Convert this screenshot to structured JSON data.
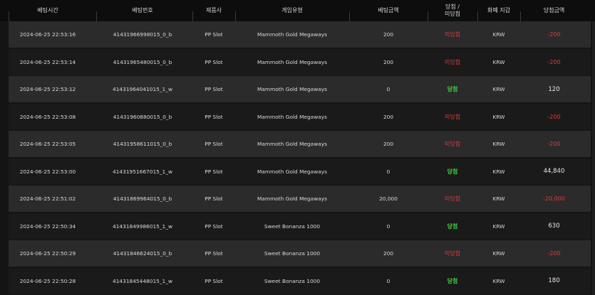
{
  "header": {
    "bet_time": "베팅시간",
    "bet_number": "베팅번호",
    "provider": "제품사",
    "game_type": "게임유형",
    "bet_amount": "베팅금액",
    "result": "당첨 /\n미당첨",
    "currency": "화폐 지갑",
    "win_amount": "당첨금액"
  },
  "colors": {
    "win": "#3fd03f",
    "lose": "#e03a3a"
  },
  "rows": [
    {
      "time": "2024-06-25 22:53:16",
      "bet_no": "41431966998015_0_b",
      "provider": "PP Slot",
      "game": "Mammoth Gold Megaways",
      "amount": "200",
      "result": "미당첨",
      "status": "lose",
      "currency": "KRW",
      "win": "-200"
    },
    {
      "time": "2024-06-25 22:53:14",
      "bet_no": "41431965480015_0_b",
      "provider": "PP Slot",
      "game": "Mammoth Gold Megaways",
      "amount": "200",
      "result": "미당첨",
      "status": "lose",
      "currency": "KRW",
      "win": "-200"
    },
    {
      "time": "2024-06-25 22:53:12",
      "bet_no": "41431964041015_1_w",
      "provider": "PP Slot",
      "game": "Mammoth Gold Megaways",
      "amount": "0",
      "result": "당첨",
      "status": "win",
      "currency": "KRW",
      "win": "120"
    },
    {
      "time": "2024-06-25 22:53:08",
      "bet_no": "41431960880015_0_b",
      "provider": "PP Slot",
      "game": "Mammoth Gold Megaways",
      "amount": "200",
      "result": "미당첨",
      "status": "lose",
      "currency": "KRW",
      "win": "-200"
    },
    {
      "time": "2024-06-25 22:53:05",
      "bet_no": "41431958611015_0_b",
      "provider": "PP Slot",
      "game": "Mammoth Gold Megaways",
      "amount": "200",
      "result": "미당첨",
      "status": "lose",
      "currency": "KRW",
      "win": "-200"
    },
    {
      "time": "2024-06-25 22:53:00",
      "bet_no": "41431951667015_1_w",
      "provider": "PP Slot",
      "game": "Mammoth Gold Megaways",
      "amount": "0",
      "result": "당첨",
      "status": "win",
      "currency": "KRW",
      "win": "44,840"
    },
    {
      "time": "2024-06-25 22:51:02",
      "bet_no": "41431869964015_0_b",
      "provider": "PP Slot",
      "game": "Mammoth Gold Megaways",
      "amount": "20,000",
      "result": "미당첨",
      "status": "lose",
      "currency": "KRW",
      "win": "-20,000"
    },
    {
      "time": "2024-06-25 22:50:34",
      "bet_no": "41431849986015_1_w",
      "provider": "PP Slot",
      "game": "Sweet Bonanza 1000",
      "amount": "0",
      "result": "당첨",
      "status": "win",
      "currency": "KRW",
      "win": "630"
    },
    {
      "time": "2024-06-25 22:50:29",
      "bet_no": "41431846624015_0_b",
      "provider": "PP Slot",
      "game": "Sweet Bonanza 1000",
      "amount": "200",
      "result": "미당첨",
      "status": "lose",
      "currency": "KRW",
      "win": "-200"
    },
    {
      "time": "2024-06-25 22:50:28",
      "bet_no": "41431845448015_1_w",
      "provider": "PP Slot",
      "game": "Sweet Bonanza 1000",
      "amount": "0",
      "result": "당첨",
      "status": "win",
      "currency": "KRW",
      "win": "180"
    }
  ]
}
